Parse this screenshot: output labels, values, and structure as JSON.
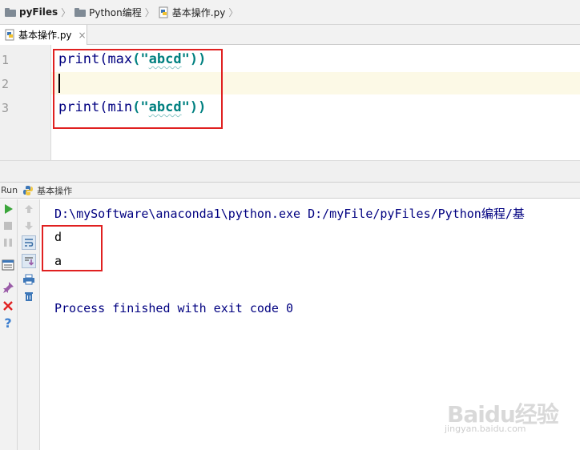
{
  "breadcrumb": {
    "items": [
      {
        "label": "pyFiles",
        "icon": "folder-icon"
      },
      {
        "label": "Python编程",
        "icon": "folder-icon"
      },
      {
        "label": "基本操作.py",
        "icon": "python-file-icon"
      }
    ]
  },
  "tabs": [
    {
      "label": "基本操作.py",
      "close": "×",
      "active": true
    }
  ],
  "editor": {
    "line_numbers": [
      "1",
      "2",
      "3"
    ],
    "current_line": 2,
    "lines": [
      {
        "fn": "print",
        "inner": "max",
        "open": "(\"",
        "arg": "abcd",
        "close": "\"))"
      },
      {
        "fn": "",
        "inner": "",
        "open": "",
        "arg": "",
        "close": ""
      },
      {
        "fn": "print",
        "inner": "min",
        "open": "(\"",
        "arg": "abcd",
        "close": "\"))"
      }
    ],
    "highlight_color": "#e02020"
  },
  "run_panel": {
    "label": "Run",
    "config_name": "基本操作",
    "toolbar_left": [
      "run-icon",
      "stop-icon",
      "pause-icon",
      "layout-icon",
      "pin-icon",
      "close-icon",
      "help-icon"
    ],
    "toolbar_right": [
      "up-arrow-icon",
      "down-arrow-icon",
      "soft-wrap-icon",
      "scroll-to-end-icon",
      "print-icon",
      "trash-icon"
    ]
  },
  "console": {
    "command": "D:\\mySoftware\\anaconda1\\python.exe D:/myFile/pyFiles/Python编程/基",
    "output": [
      "d",
      "a"
    ],
    "exit_message": "Process finished with exit code 0"
  },
  "watermark": {
    "brand": "Baidu经验",
    "site": "jingyan.baidu.com"
  },
  "colors": {
    "keyword": "#000080",
    "string": "#008080",
    "current_line_bg": "#fcf9e6",
    "run_green": "#3aa53a",
    "close_red": "#e02020",
    "help_blue": "#3d7fd0"
  }
}
